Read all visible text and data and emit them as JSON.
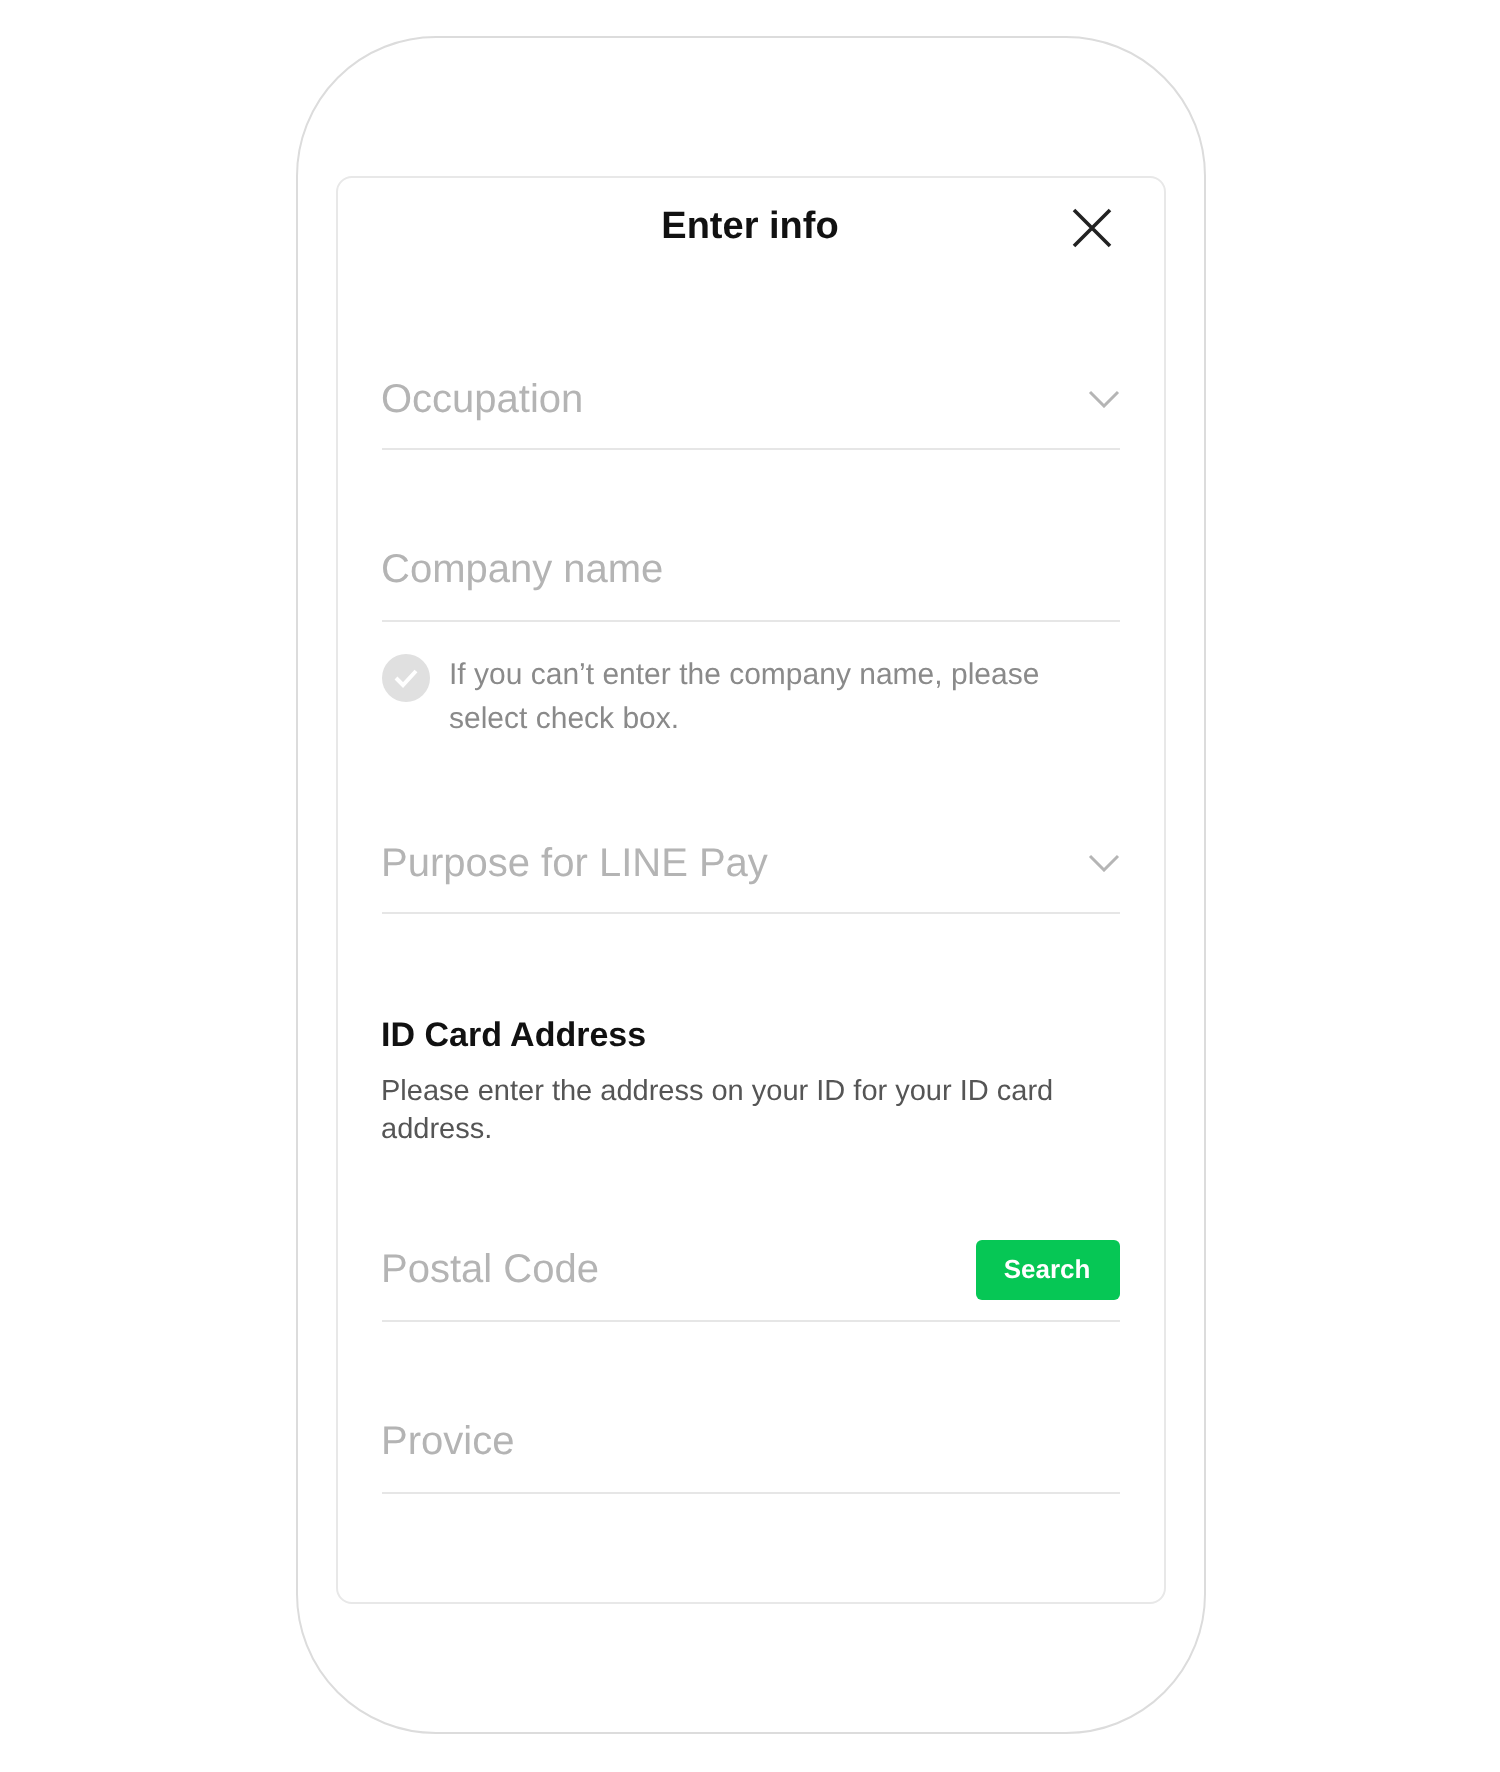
{
  "dialog": {
    "title": "Enter info"
  },
  "items": [
    {
      "kind": "select",
      "placeholder": "Occupation"
    },
    {
      "kind": "text",
      "placeholder": "Company name"
    },
    {
      "kind": "checkbox",
      "label": "If you can’t enter the company name, please select check box.",
      "checked": false
    },
    {
      "kind": "select",
      "placeholder": "Purpose for LINE Pay"
    },
    {
      "kind": "section",
      "heading": "ID Card Address",
      "text": "Please enter the address on your ID for your ID card address."
    },
    {
      "kind": "search",
      "placeholder": "Postal Code",
      "button": "Search"
    },
    {
      "kind": "text",
      "placeholder": "Provice"
    }
  ]
}
